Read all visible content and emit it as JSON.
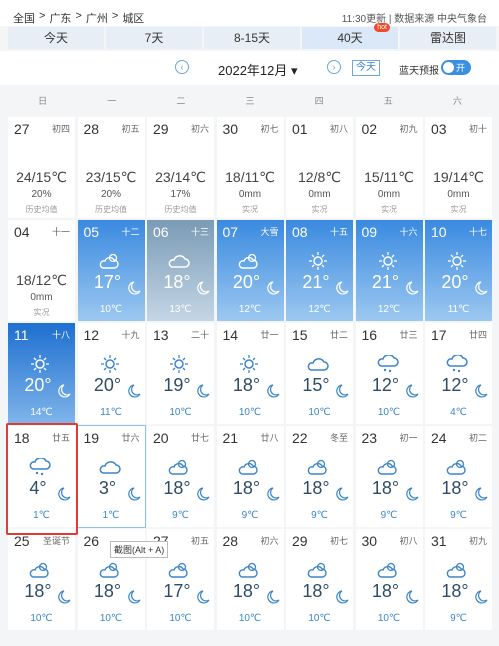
{
  "breadcrumb": [
    "全国",
    ">",
    "广东",
    ">",
    "广州",
    ">",
    "城区"
  ],
  "updated": "11:30更新 | 数据来源 中央气象台",
  "tabs": [
    {
      "label": "今天"
    },
    {
      "label": "7天"
    },
    {
      "label": "8-15天"
    },
    {
      "label": "40天",
      "badge": "hot"
    },
    {
      "label": "雷达图"
    }
  ],
  "nav": {
    "month": "2022年12月 ▾",
    "today": "今天",
    "radar_forecast": "蓝天预报",
    "toggle": "开",
    "prev": "‹",
    "next": "›"
  },
  "weekdays": [
    "日",
    "一",
    "二",
    "三",
    "四",
    "五",
    "六"
  ],
  "calendar": [
    {
      "day": "27",
      "lunar": "初四",
      "temps": "24/15℃",
      "rain": "20%",
      "note": "历史均值",
      "type": "past"
    },
    {
      "day": "28",
      "lunar": "初五",
      "temps": "23/15℃",
      "rain": "20%",
      "note": "历史均值",
      "type": "past"
    },
    {
      "day": "29",
      "lunar": "初六",
      "temps": "23/14℃",
      "rain": "17%",
      "note": "历史均值",
      "type": "past"
    },
    {
      "day": "30",
      "lunar": "初七",
      "temps": "18/11℃",
      "rain": "0mm",
      "note": "实况",
      "type": "past"
    },
    {
      "day": "01",
      "lunar": "初八",
      "temps": "12/8℃",
      "rain": "0mm",
      "note": "实况",
      "type": "past"
    },
    {
      "day": "02",
      "lunar": "初九",
      "temps": "15/11℃",
      "rain": "0mm",
      "note": "实况",
      "type": "past"
    },
    {
      "day": "03",
      "lunar": "初十",
      "temps": "19/14℃",
      "rain": "0mm",
      "note": "实况",
      "type": "past"
    },
    {
      "day": "04",
      "lunar": "十一",
      "temps": "18/12℃",
      "rain": "0mm",
      "note": "实况",
      "type": "past"
    },
    {
      "day": "05",
      "lunar": "十二",
      "hi": "17°",
      "lo": "10℃",
      "type": "blue",
      "icon": "partly-cloudy"
    },
    {
      "day": "06",
      "lunar": "十三",
      "hi": "18°",
      "lo": "13℃",
      "type": "gray",
      "icon": "cloudy"
    },
    {
      "day": "07",
      "lunar": "大雪",
      "hi": "20°",
      "lo": "12℃",
      "type": "blue",
      "icon": "partly-cloudy"
    },
    {
      "day": "08",
      "lunar": "十五",
      "hi": "21°",
      "lo": "12℃",
      "type": "blue",
      "icon": "sunny"
    },
    {
      "day": "09",
      "lunar": "十六",
      "hi": "21°",
      "lo": "12℃",
      "type": "blue",
      "icon": "sunny"
    },
    {
      "day": "10",
      "lunar": "十七",
      "hi": "20°",
      "lo": "11℃",
      "type": "blue",
      "icon": "sunny"
    },
    {
      "day": "11",
      "lunar": "十八",
      "hi": "20°",
      "lo": "14℃",
      "type": "dark",
      "icon": "sunny"
    },
    {
      "day": "12",
      "lunar": "十九",
      "hi": "20°",
      "lo": "11℃",
      "type": "white",
      "icon": "sunny"
    },
    {
      "day": "13",
      "lunar": "二十",
      "hi": "19°",
      "lo": "10℃",
      "type": "white",
      "icon": "sunny"
    },
    {
      "day": "14",
      "lunar": "廿一",
      "hi": "18°",
      "lo": "10℃",
      "type": "white",
      "icon": "sunny"
    },
    {
      "day": "15",
      "lunar": "廿二",
      "hi": "15°",
      "lo": "10℃",
      "type": "white",
      "icon": "cloudy"
    },
    {
      "day": "16",
      "lunar": "廿三",
      "hi": "12°",
      "lo": "10℃",
      "type": "white",
      "icon": "rain"
    },
    {
      "day": "17",
      "lunar": "廿四",
      "hi": "12°",
      "lo": "4℃",
      "type": "white",
      "icon": "rain"
    },
    {
      "day": "18",
      "lunar": "廿五",
      "hi": "4°",
      "lo": "1℃",
      "type": "white",
      "icon": "rain"
    },
    {
      "day": "19",
      "lunar": "廿六",
      "hi": "3°",
      "lo": "1℃",
      "type": "white",
      "icon": "cloudy",
      "selected": true
    },
    {
      "day": "20",
      "lunar": "廿七",
      "hi": "18°",
      "lo": "9℃",
      "type": "white",
      "icon": "partly-cloudy"
    },
    {
      "day": "21",
      "lunar": "廿八",
      "hi": "18°",
      "lo": "9℃",
      "type": "white",
      "icon": "partly-cloudy"
    },
    {
      "day": "22",
      "lunar": "冬至",
      "hi": "18°",
      "lo": "9℃",
      "type": "white",
      "icon": "partly-cloudy"
    },
    {
      "day": "23",
      "lunar": "初一",
      "hi": "18°",
      "lo": "9℃",
      "type": "white",
      "icon": "partly-cloudy"
    },
    {
      "day": "24",
      "lunar": "初二",
      "hi": "18°",
      "lo": "9℃",
      "type": "white",
      "icon": "partly-cloudy"
    },
    {
      "day": "25",
      "lunar": "圣诞节",
      "hi": "18°",
      "lo": "10℃",
      "type": "white",
      "icon": "partly-cloudy"
    },
    {
      "day": "26",
      "lunar": "",
      "hi": "18°",
      "lo": "10℃",
      "type": "white",
      "icon": "partly-cloudy"
    },
    {
      "day": "27",
      "lunar": "初五",
      "hi": "17°",
      "lo": "10℃",
      "type": "white",
      "icon": "partly-cloudy"
    },
    {
      "day": "28",
      "lunar": "初六",
      "hi": "18°",
      "lo": "10℃",
      "type": "white",
      "icon": "partly-cloudy"
    },
    {
      "day": "29",
      "lunar": "初七",
      "hi": "18°",
      "lo": "10℃",
      "type": "white",
      "icon": "partly-cloudy"
    },
    {
      "day": "30",
      "lunar": "初八",
      "hi": "18°",
      "lo": "10℃",
      "type": "white",
      "icon": "partly-cloudy"
    },
    {
      "day": "31",
      "lunar": "初九",
      "hi": "18°",
      "lo": "9℃",
      "type": "white",
      "icon": "partly-cloudy"
    }
  ],
  "tooltip": "截图(Alt + A)"
}
